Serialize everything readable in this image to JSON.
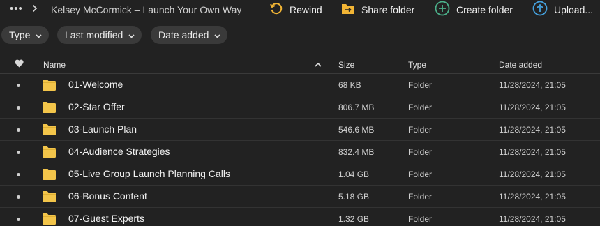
{
  "breadcrumb": {
    "more_icon": "more-dots-icon",
    "separator_icon": "chevron-right-icon",
    "title": "Kelsey McCormick – Launch Your Own Way"
  },
  "toolbar": {
    "rewind_label": "Rewind",
    "share_label": "Share folder",
    "create_label": "Create folder",
    "upload_label": "Upload..."
  },
  "filters": {
    "type_label": "Type",
    "modified_label": "Last modified",
    "added_label": "Date added"
  },
  "table": {
    "columns": {
      "name": "Name",
      "size": "Size",
      "type": "Type",
      "date": "Date added"
    },
    "rows": [
      {
        "name": "01-Welcome",
        "size": "68 KB",
        "type": "Folder",
        "date": "11/28/2024, 21:05"
      },
      {
        "name": "02-Star Offer",
        "size": "806.7 MB",
        "type": "Folder",
        "date": "11/28/2024, 21:05"
      },
      {
        "name": "03-Launch Plan",
        "size": "546.6 MB",
        "type": "Folder",
        "date": "11/28/2024, 21:05"
      },
      {
        "name": "04-Audience Strategies",
        "size": "832.4 MB",
        "type": "Folder",
        "date": "11/28/2024, 21:05"
      },
      {
        "name": "05-Live Group Launch Planning Calls",
        "size": "1.04 GB",
        "type": "Folder",
        "date": "11/28/2024, 21:05"
      },
      {
        "name": "06-Bonus Content",
        "size": "5.18 GB",
        "type": "Folder",
        "date": "11/28/2024, 21:05"
      },
      {
        "name": "07-Guest Experts",
        "size": "1.32 GB",
        "type": "Folder",
        "date": "11/28/2024, 21:05"
      }
    ]
  },
  "colors": {
    "background": "#222222",
    "rewind_accent": "#f2b535",
    "share_accent": "#f2b535",
    "create_accent": "#4bb08a",
    "upload_accent": "#45a3e0",
    "folder": "#f3c54a"
  }
}
